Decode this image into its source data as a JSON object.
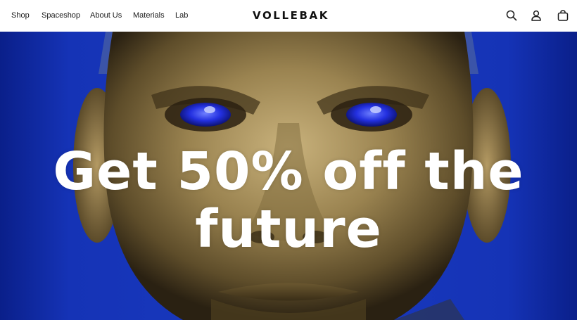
{
  "nav": {
    "links": [
      {
        "label": "Shop"
      },
      {
        "label": "Spaceshop"
      },
      {
        "label": "About Us"
      },
      {
        "label": "Materials"
      },
      {
        "label": "Lab"
      }
    ],
    "brand": "VOLLEBAK",
    "icons": [
      "search-icon",
      "account-icon",
      "bag-icon"
    ]
  },
  "hero": {
    "headline_line1": "Get 50% off the",
    "headline_line2": "future",
    "colors": {
      "background_blue": "#1533b6",
      "face_gold": "#a08a55",
      "eye_blue": "#2a3cff",
      "headline": "#ffffff"
    }
  }
}
